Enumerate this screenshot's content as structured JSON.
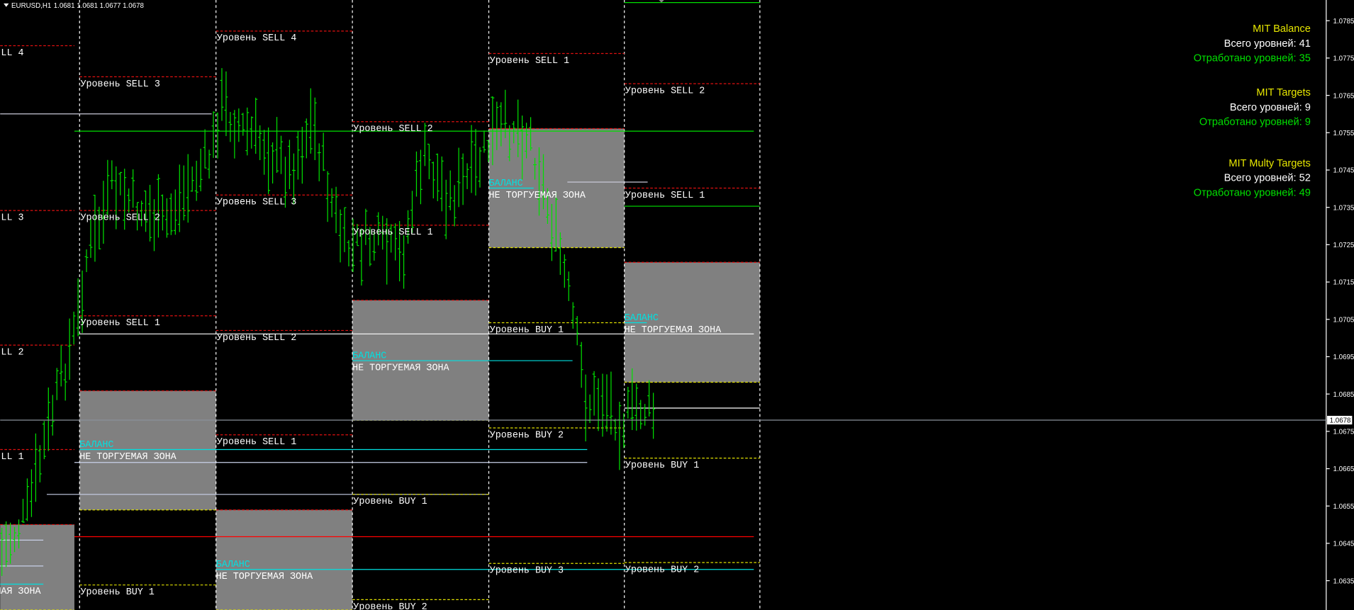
{
  "header": {
    "symbol": "EURUSD,H1",
    "prices": "1.0681 1.0681 1.0677 1.0678"
  },
  "price_axis": {
    "ticks": [
      "1.0785",
      "1.0775",
      "1.0765",
      "1.0755",
      "1.0745",
      "1.0735",
      "1.0725",
      "1.0715",
      "1.0705",
      "1.0695",
      "1.0685",
      "1.0675",
      "1.0665",
      "1.0655",
      "1.0645",
      "1.0635"
    ],
    "current": "1.0678"
  },
  "panel": [
    {
      "title": "MIT Balance",
      "total": "Всего уровней: 41",
      "done": "Отработано уровней: 35"
    },
    {
      "title": "MIT Targets",
      "total": "Всего уровней: 9",
      "done": "Отработано уровней: 9"
    },
    {
      "title": "MIT Multy Targets",
      "total": "Всего уровней: 52",
      "done": "Отработано уровней: 49"
    }
  ],
  "zone_labels": {
    "balance": "БАЛАНС",
    "no_trade": "НЕ ТОРГУЕМАЯ ЗОНА"
  },
  "level_labels": [
    "LL 4",
    "LL 3",
    "LL 2",
    "LL 1",
    "Уровень SELL 3",
    "Уровень SELL 2",
    "Уровень SELL 1",
    "Уровень BUY 1",
    "Уровень SELL 4",
    "Уровень SELL 3",
    "Уровень SELL 2",
    "Уровень SELL 1",
    "Уровень SELL 2",
    "Уровень SELL 1",
    "Уровень BUY 1",
    "Уровень BUY 2",
    "Уровень SELL 1",
    "Уровень BUY 1",
    "Уровень BUY 2",
    "Уровень BUY 3",
    "Уровень SELL 2",
    "Уровень SELL 1",
    "Уровень BUY 1",
    "Уровень BUY 2"
  ],
  "colors": {
    "background": "#000000",
    "bars": "#00e000",
    "sell": "#e01010",
    "buy": "#e0e000",
    "zone": "#808080",
    "balance": "#00e0e0",
    "panel_title": "#e6e600",
    "panel_total": "#ffffff",
    "panel_done": "#00e000"
  }
}
